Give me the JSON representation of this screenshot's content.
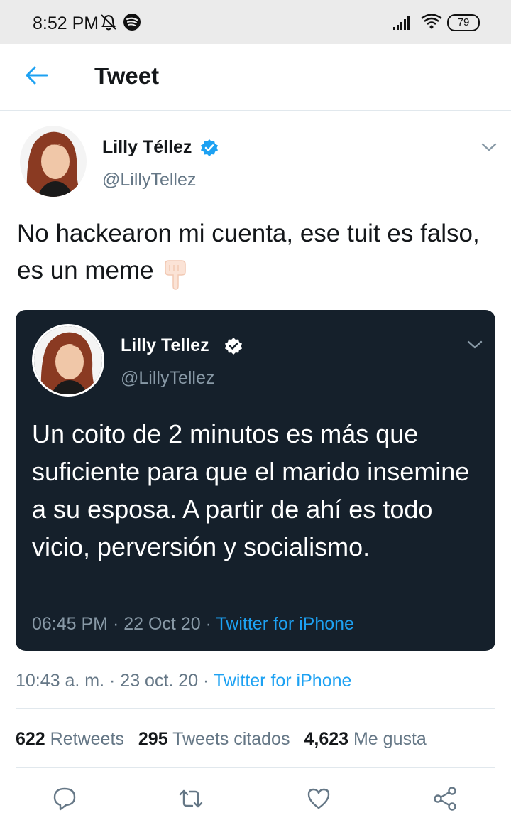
{
  "status_bar": {
    "time": "8:52 PM",
    "battery": "79"
  },
  "header": {
    "title": "Tweet"
  },
  "tweet": {
    "author_name": "Lilly Téllez",
    "handle": "@LillyTellez",
    "text": "No hackearon mi cuenta, ese tuit es falso, es un meme",
    "time": "10:43 a. m.",
    "date": "23 oct. 20",
    "source": "Twitter for iPhone"
  },
  "quoted": {
    "author_name": "Lilly Tellez",
    "handle": "@LillyTellez",
    "text": "Un coito de 2 minutos es más que suficiente para que el marido insemine a su esposa. A partir de ahí es todo vicio, perversión y socialismo.",
    "time": "06:45 PM",
    "date": "22 Oct 20",
    "source": "Twitter for iPhone"
  },
  "stats": {
    "retweets_count": "622",
    "retweets_label": "Retweets",
    "quotes_count": "295",
    "quotes_label": "Tweets citados",
    "likes_count": "4,623",
    "likes_label": "Me gusta"
  },
  "icons": {
    "status": [
      "do-not-disturb-icon",
      "spotify-icon",
      "signal-icon",
      "wifi-icon",
      "battery-icon"
    ],
    "header": "back-arrow-icon",
    "verified": "verified-badge-icon",
    "chevron": "chevron-down-icon",
    "actions": [
      "reply-icon",
      "retweet-icon",
      "like-icon",
      "share-icon"
    ]
  },
  "colors": {
    "accent": "#1da1f2",
    "card_bg": "#15202b",
    "secondary_text": "#657786"
  }
}
